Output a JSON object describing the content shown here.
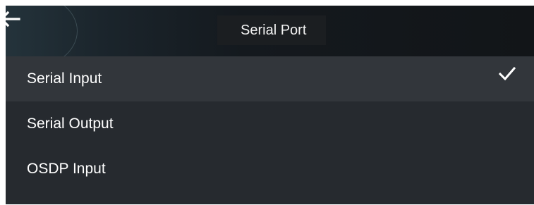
{
  "header": {
    "title": "Serial Port",
    "back_icon": "arrow-left-icon"
  },
  "menu": {
    "items": [
      {
        "label": "Serial Input",
        "selected": true
      },
      {
        "label": "Serial Output",
        "selected": false
      },
      {
        "label": "OSDP Input",
        "selected": false
      }
    ],
    "check_icon": "checkmark-icon"
  },
  "colors": {
    "header_bg": "#14191e",
    "menu_bg": "#262a2f",
    "selected_row_bg": "#32363b",
    "text": "#ffffff"
  }
}
